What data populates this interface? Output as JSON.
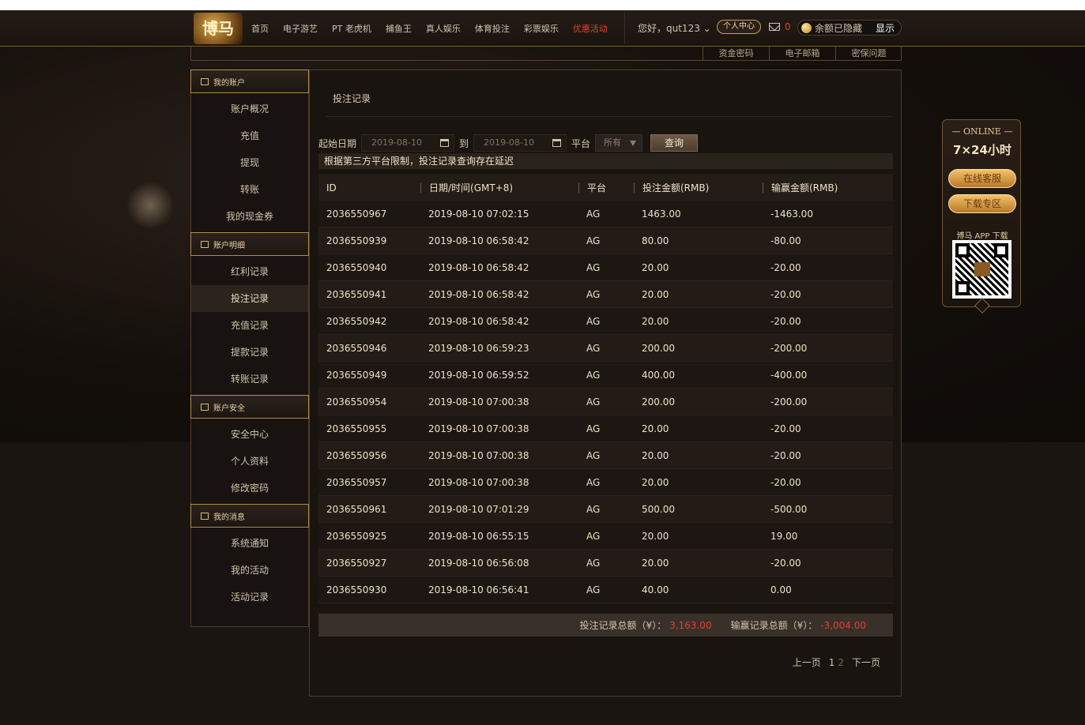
{
  "header": {
    "logo_text": "博马",
    "nav": [
      "首页",
      "电子游艺",
      "PT 老虎机",
      "捕鱼王",
      "真人娱乐",
      "体育投注",
      "彩票娱乐",
      "优惠活动"
    ],
    "greeting": "您好，qut123",
    "user_center": "个人中心",
    "mail_count": "0",
    "balance_text": "余额已隐藏",
    "show_label": "显示"
  },
  "strip_tabs": [
    "资金密码",
    "电子邮箱",
    "密保问题"
  ],
  "sidebar": {
    "groups": [
      {
        "title": "我的账户",
        "items": [
          "账户概况",
          "充值",
          "提现",
          "转账",
          "我的现金券"
        ]
      },
      {
        "title": "账户明细",
        "items": [
          "红利记录",
          "投注记录",
          "充值记录",
          "提款记录",
          "转账记录"
        ]
      },
      {
        "title": "账户安全",
        "items": [
          "安全中心",
          "个人资料",
          "修改密码"
        ]
      },
      {
        "title": "我的消息",
        "items": [
          "系统通知",
          "我的活动",
          "活动记录"
        ]
      }
    ],
    "active": "投注记录"
  },
  "main": {
    "title": "投注记录",
    "filters": {
      "start_label": "起始日期",
      "start_date": "2019-08-10",
      "to_label": "到",
      "end_date": "2019-08-10",
      "platform_label": "平台",
      "platform_value": "所有",
      "query_label": "查询"
    },
    "notice": "根据第三方平台限制，投注记录查询存在延迟",
    "table": {
      "headers": [
        "ID",
        "日期/时间(GMT+8)",
        "平台",
        "投注金额(RMB)",
        "输赢金额(RMB)"
      ],
      "rows": [
        [
          "2036550967",
          "2019-08-10 07:02:15",
          "AG",
          "1463.00",
          "-1463.00"
        ],
        [
          "2036550939",
          "2019-08-10 06:58:42",
          "AG",
          "80.00",
          "-80.00"
        ],
        [
          "2036550940",
          "2019-08-10 06:58:42",
          "AG",
          "20.00",
          "-20.00"
        ],
        [
          "2036550941",
          "2019-08-10 06:58:42",
          "AG",
          "20.00",
          "-20.00"
        ],
        [
          "2036550942",
          "2019-08-10 06:58:42",
          "AG",
          "20.00",
          "-20.00"
        ],
        [
          "2036550946",
          "2019-08-10 06:59:23",
          "AG",
          "200.00",
          "-200.00"
        ],
        [
          "2036550949",
          "2019-08-10 06:59:52",
          "AG",
          "400.00",
          "-400.00"
        ],
        [
          "2036550954",
          "2019-08-10 07:00:38",
          "AG",
          "200.00",
          "-200.00"
        ],
        [
          "2036550955",
          "2019-08-10 07:00:38",
          "AG",
          "20.00",
          "-20.00"
        ],
        [
          "2036550956",
          "2019-08-10 07:00:38",
          "AG",
          "20.00",
          "-20.00"
        ],
        [
          "2036550957",
          "2019-08-10 07:00:38",
          "AG",
          "20.00",
          "-20.00"
        ],
        [
          "2036550961",
          "2019-08-10 07:01:29",
          "AG",
          "500.00",
          "-500.00"
        ],
        [
          "2036550925",
          "2019-08-10 06:55:15",
          "AG",
          "20.00",
          "19.00"
        ],
        [
          "2036550927",
          "2019-08-10 06:56:08",
          "AG",
          "20.00",
          "-20.00"
        ],
        [
          "2036550930",
          "2019-08-10 06:56:41",
          "AG",
          "40.00",
          "0.00"
        ]
      ]
    },
    "summary": {
      "bet_label": "投注记录总额（¥）：",
      "bet_total": "3,163.00",
      "win_label": "输赢记录总额（¥）：",
      "win_total": "-3,004.00"
    },
    "pager": {
      "prev": "上一页",
      "page1": "1",
      "page2": "2",
      "next": "下一页"
    }
  },
  "float_panel": {
    "online": "— ONLINE —",
    "hours": "7×24小时",
    "service": "在线客服",
    "download": "下载专区",
    "app_label": "博马 APP 下载"
  },
  "colors": {
    "accent_red": "#e0422d",
    "gold": "#c9a05a",
    "bg": "#1a1410"
  }
}
